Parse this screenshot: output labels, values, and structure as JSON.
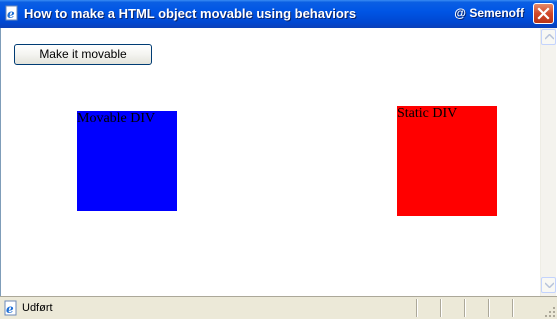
{
  "window": {
    "title": "How to make a HTML object movable using behaviors",
    "title_right": "@ Semenoff"
  },
  "page": {
    "button_label": "Make it movable",
    "movable_div_text": "Movable DIV",
    "static_div_text": "Static DIV"
  },
  "statusbar": {
    "text": "Udført"
  },
  "colors": {
    "movable_div": "#0000ff",
    "static_div": "#ff0000",
    "titlebar": "#0055e5"
  },
  "icons": {
    "title": "ie-page-icon",
    "close": "close-icon",
    "status": "ie-page-icon",
    "scroll_up": "scroll-up-arrow-icon",
    "scroll_down": "scroll-down-arrow-icon"
  }
}
